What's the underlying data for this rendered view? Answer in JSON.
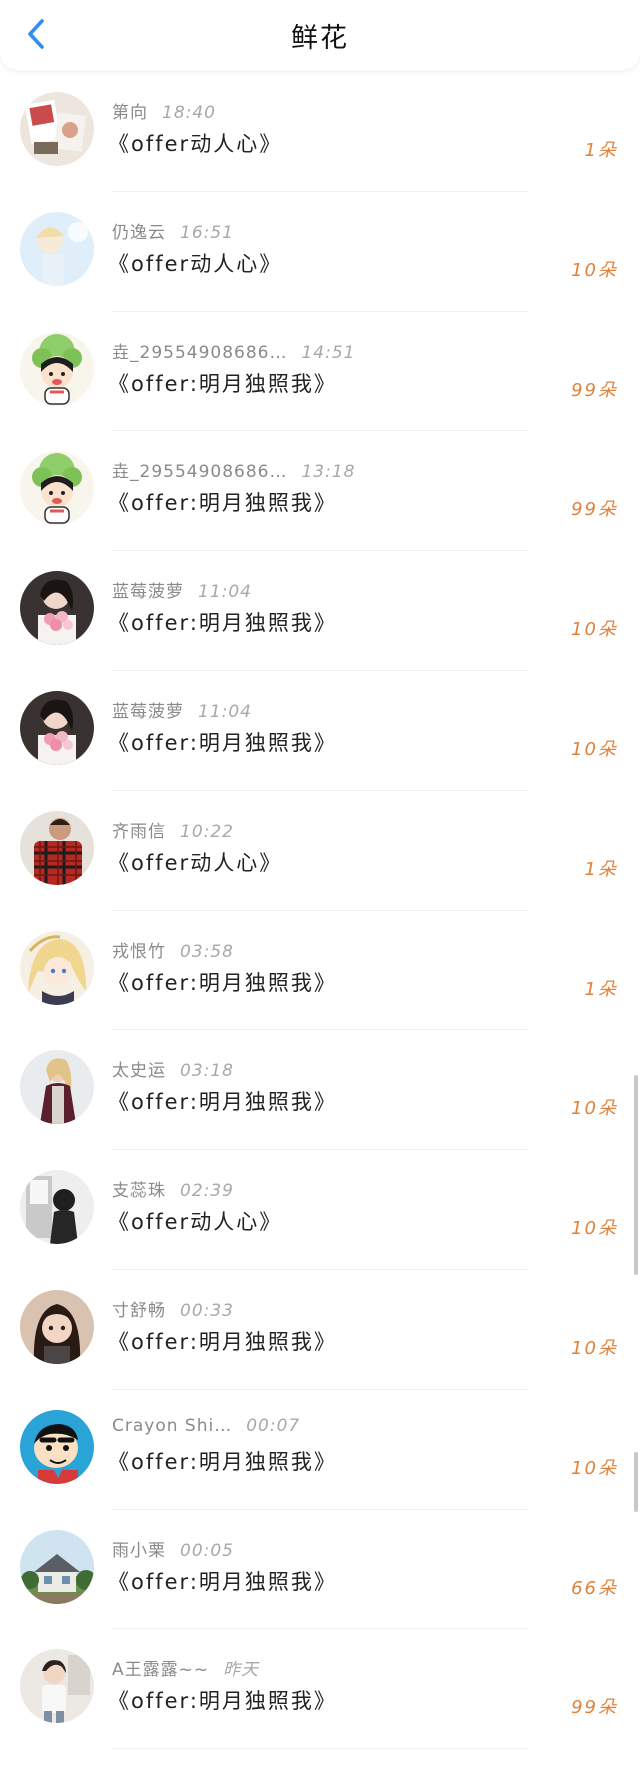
{
  "header": {
    "title": "鲜花"
  },
  "colors": {
    "accent": "#2f8ff0",
    "count": "#e0823a",
    "meta": "#8a8a8a"
  },
  "rows": [
    {
      "name": "第向",
      "time": "18:40",
      "gift": "《offer动人心》",
      "count": "1朵",
      "avatar": "photo-postcards"
    },
    {
      "name": "仍逸云",
      "time": "16:51",
      "gift": "《offer动人心》",
      "count": "10朵",
      "avatar": "photo-child"
    },
    {
      "name": "垚_29554908686…",
      "time": "14:51",
      "gift": "《offer:明月独照我》",
      "count": "99朵",
      "avatar": "cartoon-cabbage-kid"
    },
    {
      "name": "垚_29554908686…",
      "time": "13:18",
      "gift": "《offer:明月独照我》",
      "count": "99朵",
      "avatar": "cartoon-cabbage-kid"
    },
    {
      "name": "蓝莓菠萝",
      "time": "11:04",
      "gift": "《offer:明月独照我》",
      "count": "10朵",
      "avatar": "photo-girl-flowers"
    },
    {
      "name": "蓝莓菠萝",
      "time": "11:04",
      "gift": "《offer:明月独照我》",
      "count": "10朵",
      "avatar": "photo-girl-flowers"
    },
    {
      "name": "齐雨信",
      "time": "10:22",
      "gift": "《offer动人心》",
      "count": "1朵",
      "avatar": "photo-plaid-shirt"
    },
    {
      "name": "戎恨竹",
      "time": "03:58",
      "gift": "《offer:明月独照我》",
      "count": "1朵",
      "avatar": "anime-blonde"
    },
    {
      "name": "太史运",
      "time": "03:18",
      "gift": "《offer:明月独照我》",
      "count": "10朵",
      "avatar": "photo-woman-coat"
    },
    {
      "name": "支蕊珠",
      "time": "02:39",
      "gift": "《offer动人心》",
      "count": "10朵",
      "avatar": "photo-figure-dark"
    },
    {
      "name": "寸舒畅",
      "time": "00:33",
      "gift": "《offer:明月独照我》",
      "count": "10朵",
      "avatar": "photo-little-girl"
    },
    {
      "name": "Crayon Shi…",
      "time": "00:07",
      "gift": "《offer:明月独照我》",
      "count": "10朵",
      "avatar": "cartoon-crayon"
    },
    {
      "name": "雨小栗",
      "time": "00:05",
      "gift": "《offer:明月独照我》",
      "count": "66朵",
      "avatar": "photo-house"
    },
    {
      "name": "A王露露~~",
      "time": "昨天",
      "gift": "《offer:明月独照我》",
      "count": "99朵",
      "avatar": "photo-kid-white"
    }
  ]
}
